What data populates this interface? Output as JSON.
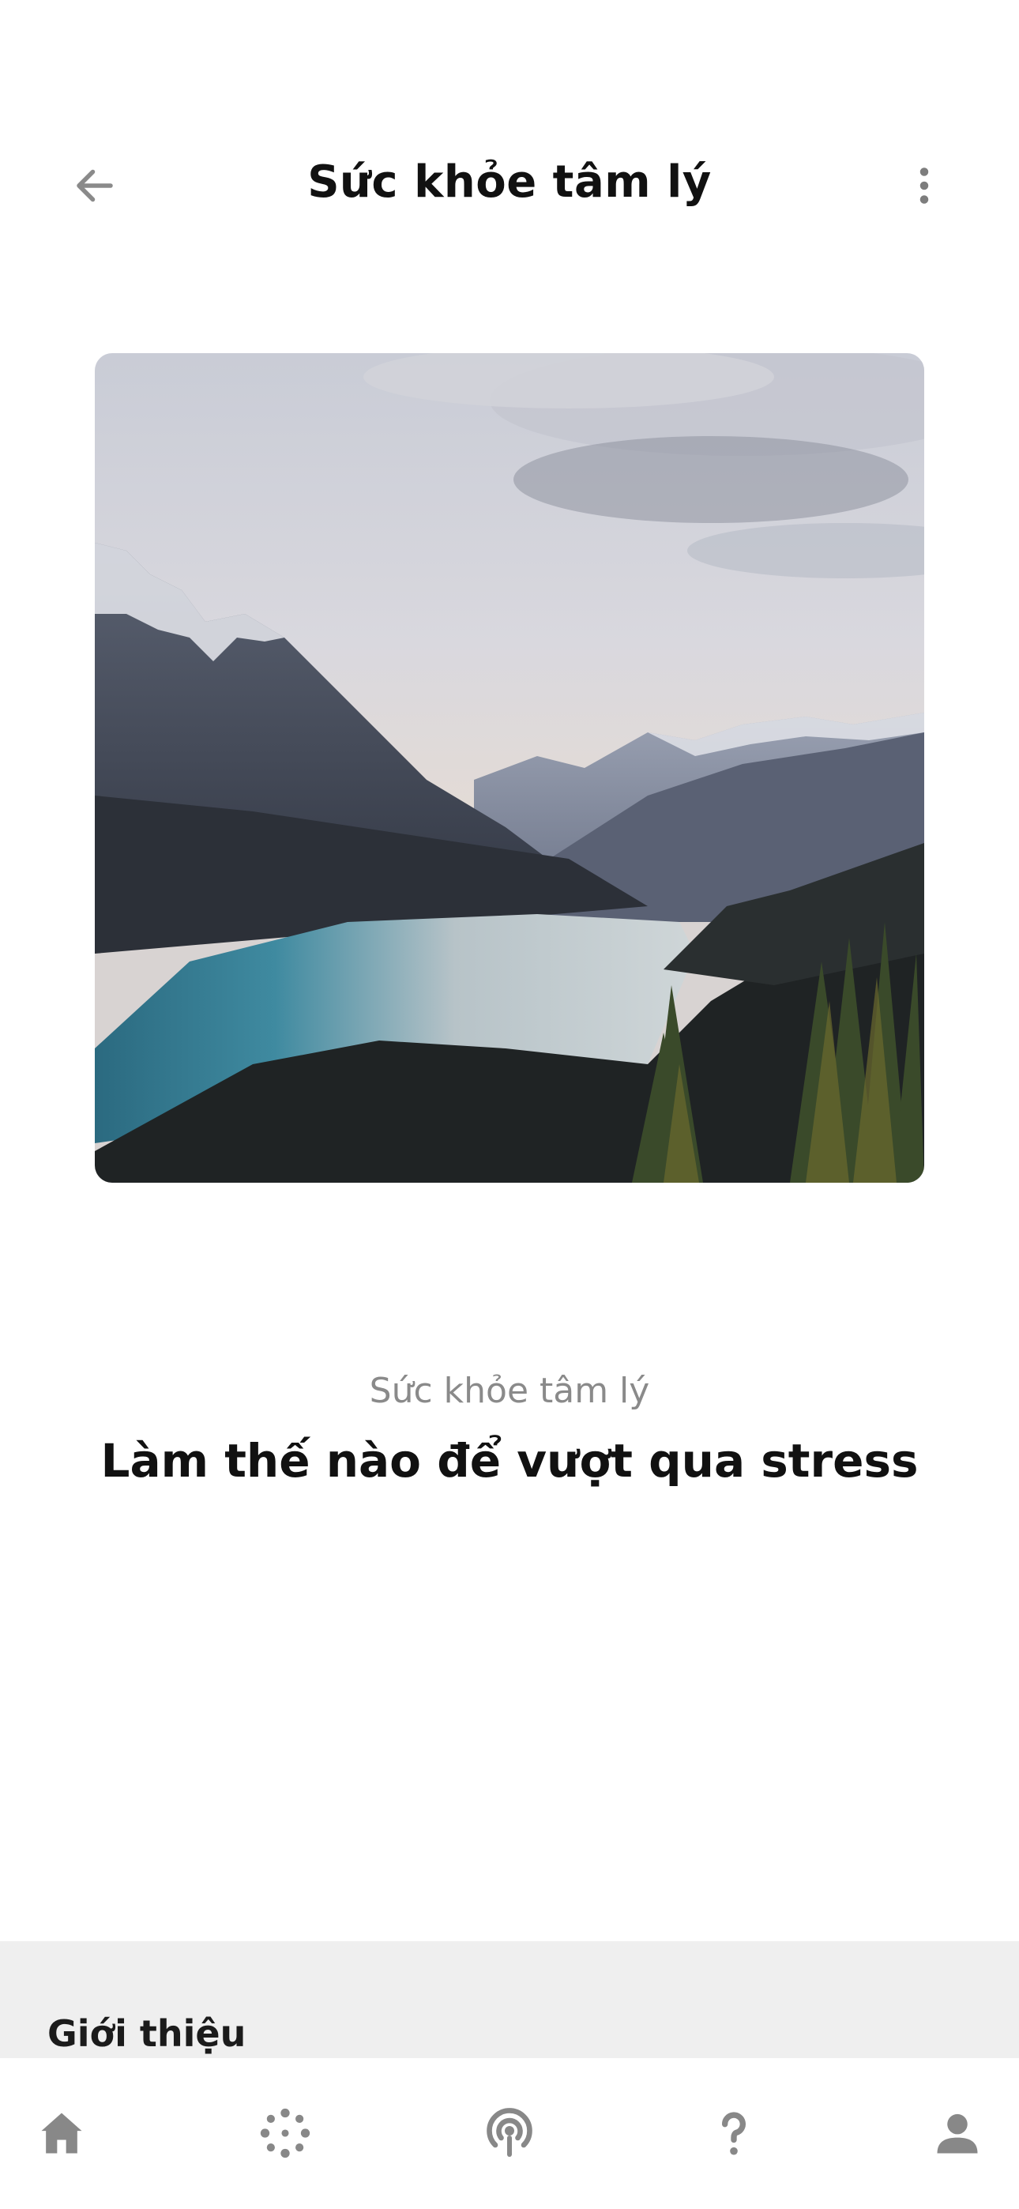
{
  "header": {
    "title": "Sức khỏe tâm lý",
    "back_icon": "arrow-left-icon",
    "more_icon": "more-vertical-icon"
  },
  "hero": {
    "subject": "mountain-lake-landscape"
  },
  "article": {
    "category": "Sức khỏe tâm lý",
    "title": "Làm thế nào để vượt qua stress"
  },
  "intro": {
    "label": "Giới thiệu"
  },
  "bottom_nav": {
    "items": [
      {
        "icon": "home-icon"
      },
      {
        "icon": "sparkle-icon"
      },
      {
        "icon": "podcast-icon"
      },
      {
        "icon": "help-icon"
      },
      {
        "icon": "profile-icon"
      }
    ]
  },
  "colors": {
    "title": "#111111",
    "category": "#8a8a8a",
    "icon": "#888888",
    "panel": "#efefef"
  }
}
